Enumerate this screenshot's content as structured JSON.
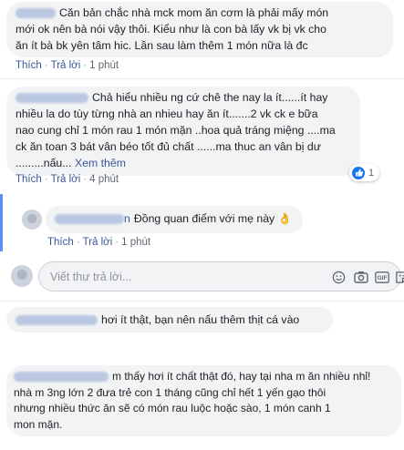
{
  "comments": [
    {
      "text": "Căn bản chắc nhà mck mom ăn cơm là phải mấy món\nmới ok nên bà nói vậy thôi. Kiểu như là con bà lấy vk bị vk cho\năn ít bà bk yên tâm hic. Lần sau làm thêm 1 món nữa là đc",
      "like": "Thích",
      "reply": "Trả lời",
      "time": "1 phút"
    },
    {
      "text": "Chả hiểu nhiều ng cứ chê the nay la ít......ít hay\nnhiều la do tùy từng nhà an nhieu hay ăn ít.......2 vk ck e bữa\nnao cung chỉ 1 món rau 1 món mặn ..hoa quả tráng miệng ....ma\nck ăn toan 3 bát vân béo tốt đủ chất ......ma thuc an vân bị dư\n.........nấu...",
      "see_more": "Xem thêm",
      "like": "Thích",
      "reply": "Trả lời",
      "time": "4 phút",
      "reaction_count": "1"
    },
    {
      "text": "Đồng quan điểm với mẹ này",
      "name_tail": "n",
      "emoji": "👌",
      "like": "Thích",
      "reply": "Trả lời",
      "time": "1 phút"
    },
    {
      "text": "hơi ít thật, bạn nên nấu thêm thịt cá vào"
    },
    {
      "text": "m thấy hơi ít chất thật đó, hay tại nha m ăn nhiều nhỉ!\nnhà m 3ng lớn 2 đưa trẻ con 1 tháng cũng chỉ hết 1 yến gạo thôi\nnhưng nhiều thức ăn sẽ có món rau luộc hoặc sào, 1 món canh 1\nmon mặn."
    }
  ],
  "reply_input": {
    "placeholder": "Viết thư trả lời..."
  },
  "icons": [
    "emoji-icon",
    "camera-icon",
    "gif-icon",
    "sticker-icon",
    "thumbs-up-icon"
  ],
  "colors": {
    "link": "#385898",
    "bubble": "#f2f3f5",
    "accent": "#1877f2",
    "thread": "#5890ff"
  }
}
